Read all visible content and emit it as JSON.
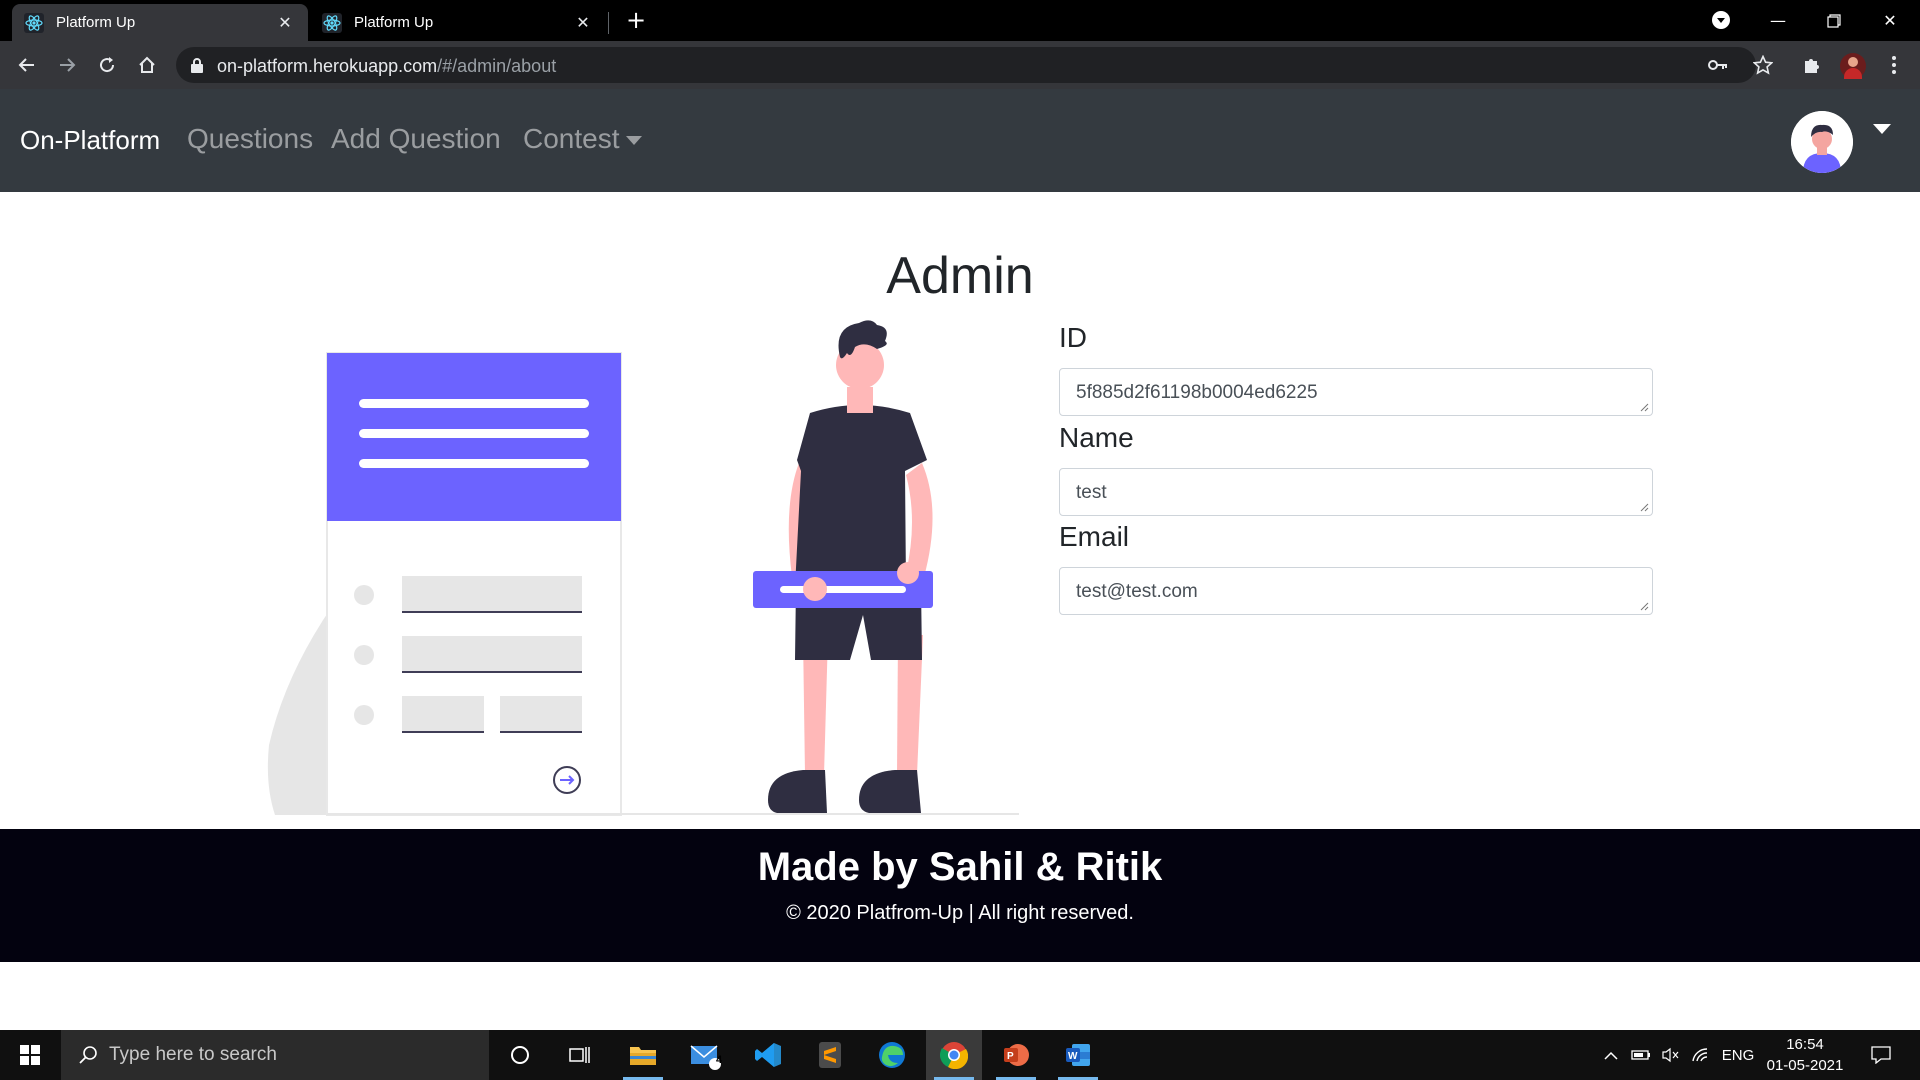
{
  "browser": {
    "tabs": [
      {
        "title": "Platform Up",
        "active": true
      },
      {
        "title": "Platform Up",
        "active": false
      }
    ],
    "url_host": "on-platform.herokuapp.com",
    "url_path": "/#/admin/about"
  },
  "navbar": {
    "brand": "On-Platform",
    "links": [
      "Questions",
      "Add Question",
      "Contest"
    ]
  },
  "main": {
    "title": "Admin",
    "fields": [
      {
        "label": "ID",
        "value": "5f885d2f61198b0004ed6225"
      },
      {
        "label": "Name",
        "value": "test"
      },
      {
        "label": "Email",
        "value": "test@test.com"
      }
    ]
  },
  "footer": {
    "title": "Made by Sahil & Ritik",
    "copyright": "© 2020 Platfrom-Up | All right reserved."
  },
  "taskbar": {
    "search_placeholder": "Type here to search",
    "mail_badge": "4",
    "language": "ENG",
    "time": "16:54",
    "date": "01-05-2021"
  },
  "colors": {
    "navbar": "#343a40",
    "illustration_accent": "#6c63ff",
    "footer": "#03020f"
  }
}
